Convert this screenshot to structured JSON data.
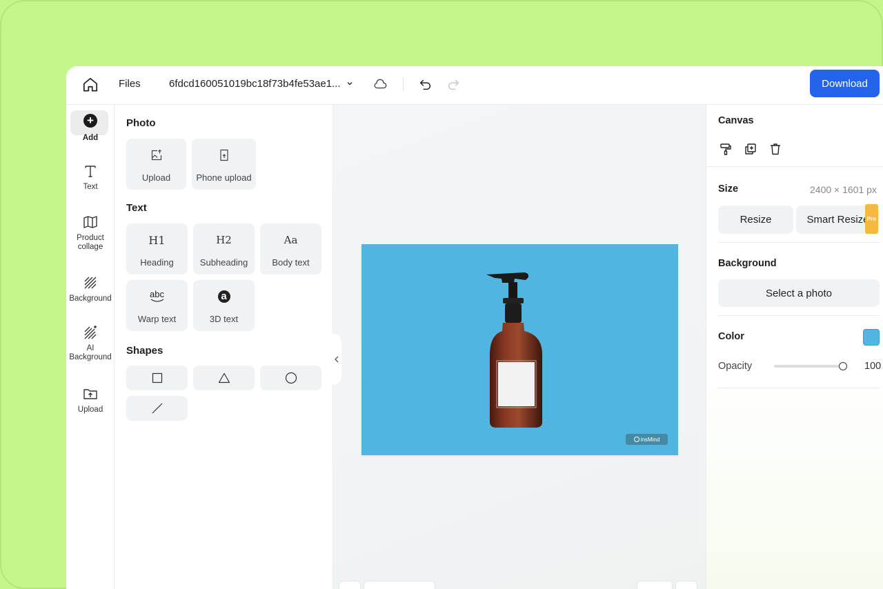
{
  "topbar": {
    "files_label": "Files",
    "filename": "6fdcd160051019bc18f73b4fe53ae1...",
    "download_label": "Download"
  },
  "rail": {
    "items": [
      {
        "label": "Add",
        "icon": "plus-circle-icon"
      },
      {
        "label": "Text",
        "icon": "text-icon"
      },
      {
        "label": "Product collage",
        "icon": "map-icon"
      },
      {
        "label": "Background",
        "icon": "hatch-icon"
      },
      {
        "label": "AI Background",
        "icon": "ai-hatch-icon"
      },
      {
        "label": "Upload",
        "icon": "upload-folder-icon"
      }
    ]
  },
  "panel": {
    "photo_title": "Photo",
    "photo_items": [
      "Upload",
      "Phone upload"
    ],
    "text_title": "Text",
    "text_items": [
      {
        "glyph": "H1",
        "label": "Heading"
      },
      {
        "glyph": "H2",
        "label": "Subheading"
      },
      {
        "glyph": "Aa",
        "label": "Body text"
      },
      {
        "glyph": "abc",
        "label": "Warp text"
      },
      {
        "glyph": "a",
        "label": "3D text"
      }
    ],
    "shapes_title": "Shapes"
  },
  "canvas": {
    "background_color": "#52b5e0",
    "watermark": "insMind"
  },
  "right": {
    "canvas_title": "Canvas",
    "size_title": "Size",
    "size_value": "2400 × 1601 px",
    "resize_label": "Resize",
    "smart_resize_label": "Smart Resize",
    "pro_badge": "Pro",
    "background_title": "Background",
    "select_photo_label": "Select a photo",
    "color_title": "Color",
    "color_value": "#52b5e0",
    "opacity_label": "Opacity",
    "opacity_value": "100"
  },
  "colors": {
    "accent": "#2463eb",
    "frame": "#c4f78a"
  }
}
